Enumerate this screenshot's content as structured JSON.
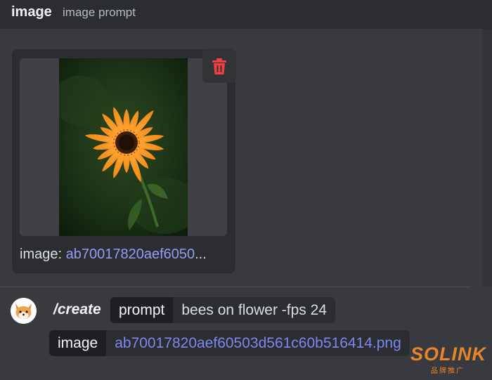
{
  "header": {
    "title": "image",
    "description": "image prompt"
  },
  "attachment": {
    "label": "image: ",
    "filename_truncated": "ab70017820aef6050",
    "ellipsis": "..."
  },
  "command": {
    "name": "/create",
    "options": [
      {
        "name": "prompt",
        "value": "bees on flower -fps 24"
      },
      {
        "name": "image",
        "value": "ab70017820aef60503d561c60b516414.png"
      }
    ]
  },
  "watermark": {
    "main": "SOLINK",
    "sub": "品牌推广"
  },
  "colors": {
    "background": "#383a40",
    "header": "#2b2d31",
    "link": "#949cf7",
    "delete": "#f23f43",
    "watermark": "#e8852b"
  },
  "icons": {
    "delete": "trash-icon",
    "avatar": "fox-avatar"
  }
}
